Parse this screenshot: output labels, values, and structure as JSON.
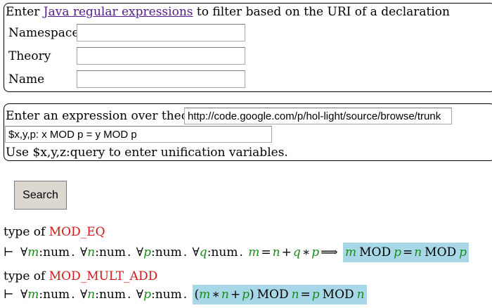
{
  "uri_filter": {
    "intro_before": "Enter ",
    "intro_link": "Java regular expressions",
    "intro_after": " to filter based on the URI of a declaration",
    "namespace_label": "Namespace",
    "namespace_value": "",
    "theory_label": "Theory",
    "theory_value": "",
    "name_label": "Name",
    "name_value": ""
  },
  "expression": {
    "prompt": "Enter an expression over theory",
    "theory_value": "http://code.google.com/p/hol-light/source/browse/trunk",
    "query_value": "$x,y,p: x MOD p = y MOD p",
    "hint": "Use $x,y,z:query to enter unification variables."
  },
  "search_button": "Search",
  "results": [
    {
      "type_of_label": "type of",
      "name": "MOD_EQ"
    },
    {
      "type_of_label": "type of",
      "name": "MOD_MULT_ADD"
    }
  ],
  "formula_tokens": {
    "turnstile": "⊢",
    "forall": "∀",
    "colon": ":",
    "num": "num",
    "dot": ".",
    "eq": "=",
    "plus": "+",
    "times": "∗",
    "implies": "⟹",
    "mod": "MOD",
    "lparen": "(",
    "rparen": ")",
    "m": "m",
    "n": "n",
    "p": "p",
    "q": "q"
  },
  "colors": {
    "constant_name": "#d01818",
    "variable": "#1a8c1a",
    "highlight": "#a8d8e8",
    "link": "#551a8b"
  }
}
